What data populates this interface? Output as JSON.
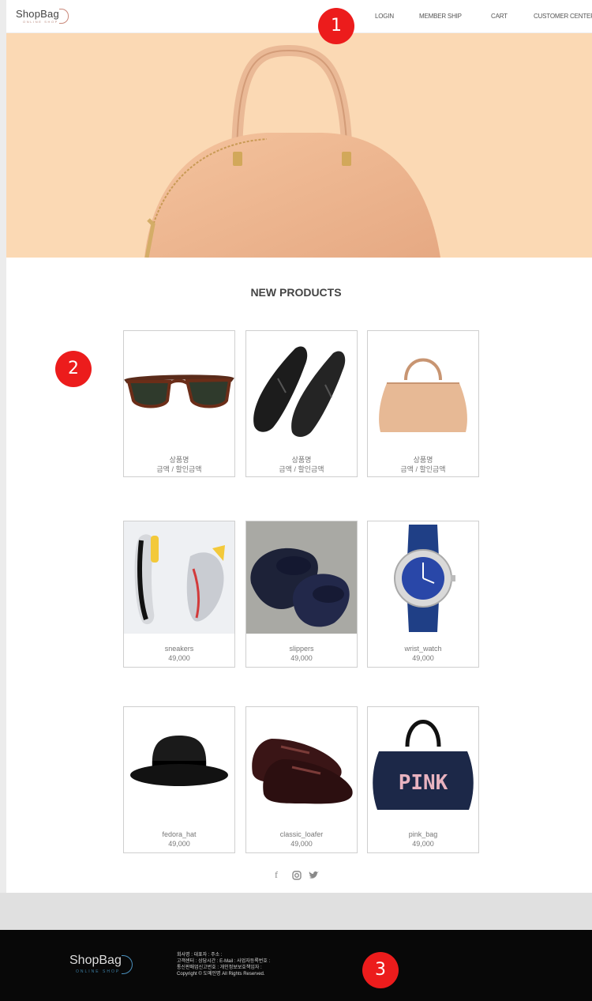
{
  "header": {
    "logo_text": "ShopBag",
    "logo_sub": "ONLINE SHOP",
    "nav": [
      "LOGIN",
      "MEMBER SHIP",
      "CART",
      "CUSTOMER CENTER"
    ]
  },
  "main": {
    "section_title": "NEW PRODUCTS",
    "products": [
      {
        "name": "상품명",
        "price": "금액 / 할인금액",
        "icon": "sunglasses-icon"
      },
      {
        "name": "상품명",
        "price": "금액 / 할인금액",
        "icon": "loafers-icon"
      },
      {
        "name": "상품명",
        "price": "금액 / 할인금액",
        "icon": "handbag-icon"
      },
      {
        "name": "sneakers",
        "price": "49,000",
        "icon": "sneakers-icon"
      },
      {
        "name": "slippers",
        "price": "49,000",
        "icon": "slippers-icon"
      },
      {
        "name": "wrist_watch",
        "price": "49,000",
        "icon": "wrist-watch-icon"
      },
      {
        "name": "fedora_hat",
        "price": "49,000",
        "icon": "fedora-hat-icon"
      },
      {
        "name": "classic_loafer",
        "price": "49,000",
        "icon": "loafer-icon"
      },
      {
        "name": "pink_bag",
        "price": "49,000",
        "icon": "pink-bag-icon",
        "bag_text": "PINK"
      }
    ]
  },
  "social": {
    "facebook": "f",
    "instagram": "instagram-icon",
    "twitter": "twitter-icon"
  },
  "footer": {
    "logo_text": "ShopBag",
    "logo_sub": "ONLINE SHOP",
    "lines": [
      "회사명 : 대표자 : 주소 :",
      "고객센터 : 상담시간 : E-Mail : 사업자등록번호 :",
      "통신판매업신고번호 : 개인정보보호책임자 :",
      "Copyright © 도메인명 All Rights Reserved."
    ]
  },
  "markers": [
    "1",
    "2",
    "3"
  ],
  "colors": {
    "accent_marker": "#ec1c1c",
    "hero_bg": "#fbd9b4",
    "footer_bg": "#080808"
  }
}
